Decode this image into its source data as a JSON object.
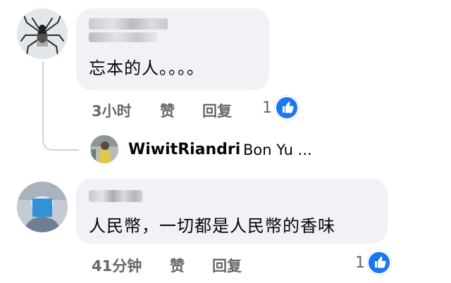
{
  "comments": [
    {
      "text": "忘本的人。。。。",
      "time": "3小时",
      "like_label": "赞",
      "reply_label": "回复",
      "reaction_count": "1",
      "reaction_icon": "thumbs-up-icon"
    },
    {
      "text": "人民幣，一切都是人民幣的香味",
      "time": "41分钟",
      "like_label": "赞",
      "reply_label": "回复",
      "reaction_count": "1",
      "reaction_icon": "thumbs-up-icon"
    }
  ],
  "reply_preview": {
    "author": "WiwitRiandri",
    "snippet": "Bon Yu ..."
  },
  "colors": {
    "bubble": "#f0f2f5",
    "meta_text": "#65676b",
    "like_blue": "#1877f2",
    "thread_line": "#ced0d4"
  }
}
